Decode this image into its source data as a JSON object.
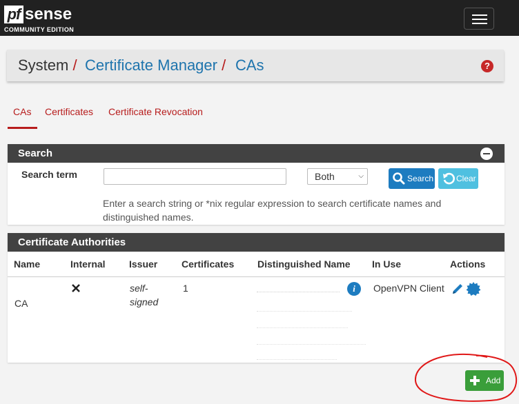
{
  "brand": {
    "logo_mark": "pf",
    "logo_word": "sense",
    "edition": "COMMUNITY EDITION"
  },
  "breadcrumb": {
    "part1": "System",
    "part2": "Certificate Manager",
    "part3": "CAs",
    "separator": "/"
  },
  "tabs": [
    "CAs",
    "Certificates",
    "Certificate Revocation"
  ],
  "search_panel": {
    "title": "Search",
    "term_label": "Search term",
    "term_value": "",
    "scope_selected": "Both",
    "search_button": "Search",
    "clear_button": "Clear",
    "help": "Enter a search string or *nix regular expression to search certificate names and distinguished names."
  },
  "ca_panel": {
    "title": "Certificate Authorities",
    "columns": [
      "Name",
      "Internal",
      "Issuer",
      "Certificates",
      "Distinguished Name",
      "In Use",
      "Actions"
    ],
    "row": {
      "name_visible": "CA",
      "internal_icon": "close-icon",
      "issuer_line1": "self-",
      "issuer_line2": "signed",
      "certificates": "1",
      "in_use": "OpenVPN Client",
      "info_glyph": "i"
    }
  },
  "add_button": "Add",
  "colors": {
    "navbar": "#212121",
    "accent_red": "#b71c1c",
    "link_blue": "#1e74ad",
    "panel_head": "#424242",
    "add_green": "#3a9e3a",
    "search_blue": "#1d7cc0",
    "clear_cyan": "#4fc0e0"
  }
}
